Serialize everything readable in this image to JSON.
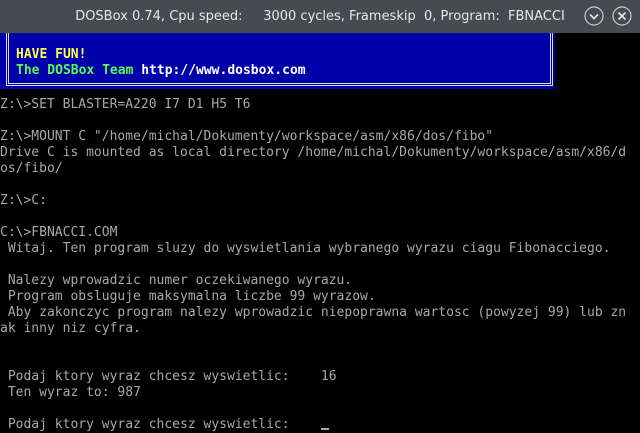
{
  "window": {
    "title": "DOSBox 0.74, Cpu speed:     3000 cycles, Frameskip  0, Program:  FBNACCI",
    "minimize_icon": "chevron-down-icon",
    "close_icon": "close-icon"
  },
  "banner": {
    "line1": "HAVE FUN!",
    "line2_team": "The DOSBox Team ",
    "line2_url": "http://www.dosbox.com"
  },
  "terminal": {
    "lines": [
      "Z:\\>SET BLASTER=A220 I7 D1 H5 T6",
      "",
      "Z:\\>MOUNT C \"/home/michal/Dokumenty/workspace/asm/x86/dos/fibo\"",
      "Drive C is mounted as local directory /home/michal/Dokumenty/workspace/asm/x86/d",
      "os/fibo/",
      "",
      "Z:\\>C:",
      "",
      "C:\\>FBNACCI.COM",
      " Witaj. Ten program sluzy do wyswietlania wybranego wyrazu ciagu Fibonacciego.",
      "",
      " Nalezy wprowadzic numer oczekiwanego wyrazu.",
      " Program obsluguje maksymalna liczbe 99 wyrazow.",
      " Aby zakonczyc program nalezy wprowadzic niepoprawna wartosc (powyzej 99) lub zn",
      "ak inny niz cyfra.",
      "",
      "",
      " Podaj ktory wyraz chcesz wyswietlic:    16",
      " Ten wyraz to: 987",
      "",
      " Podaj ktory wyraz chcesz wyswietlic:    "
    ]
  },
  "colors": {
    "banner_bg": "#0000aa",
    "banner_text_yellow": "#fcfc54",
    "banner_text_green": "#54fc54",
    "terminal_text": "#a8a8a8",
    "titlebar_bg": "#474b50"
  }
}
